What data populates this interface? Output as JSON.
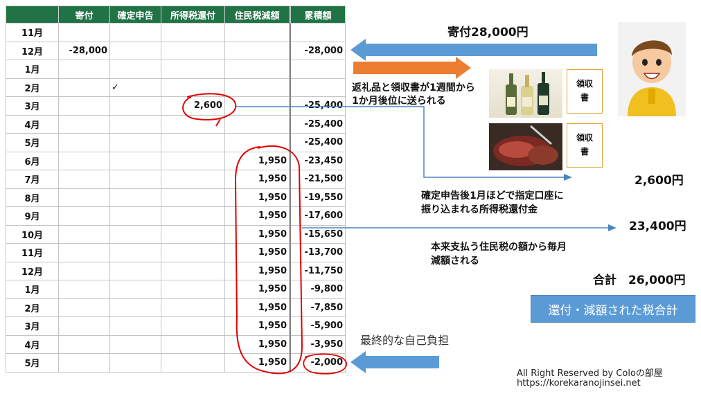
{
  "table": {
    "headers": [
      "",
      "寄付",
      "確定申告",
      "所得税還付",
      "住民税減額",
      "累積額"
    ],
    "rows": [
      [
        "11月",
        "",
        "",
        "",
        "",
        ""
      ],
      [
        "12月",
        "-28,000",
        "",
        "",
        "",
        "-28,000"
      ],
      [
        "1月",
        "",
        "",
        "",
        "",
        ""
      ],
      [
        "2月",
        "",
        "✓",
        "",
        "",
        ""
      ],
      [
        "3月",
        "",
        "",
        "2,600",
        "",
        "-25,400"
      ],
      [
        "4月",
        "",
        "",
        "",
        "",
        "-25,400"
      ],
      [
        "5月",
        "",
        "",
        "",
        "",
        "-25,400"
      ],
      [
        "6月",
        "",
        "",
        "",
        "1,950",
        "-23,450"
      ],
      [
        "7月",
        "",
        "",
        "",
        "1,950",
        "-21,500"
      ],
      [
        "8月",
        "",
        "",
        "",
        "1,950",
        "-19,550"
      ],
      [
        "9月",
        "",
        "",
        "",
        "1,950",
        "-17,600"
      ],
      [
        "10月",
        "",
        "",
        "",
        "1,950",
        "-15,650"
      ],
      [
        "11月",
        "",
        "",
        "",
        "1,950",
        "-13,700"
      ],
      [
        "12月",
        "",
        "",
        "",
        "1,950",
        "-11,750"
      ],
      [
        "1月",
        "",
        "",
        "",
        "1,950",
        "-9,800"
      ],
      [
        "2月",
        "",
        "",
        "",
        "1,950",
        "-7,850"
      ],
      [
        "3月",
        "",
        "",
        "",
        "1,950",
        "-5,900"
      ],
      [
        "4月",
        "",
        "",
        "",
        "1,950",
        "-3,950"
      ],
      [
        "5月",
        "",
        "",
        "",
        "1,950",
        "-2,000"
      ]
    ]
  },
  "annotations": {
    "donation": "寄付28,000円",
    "gift_line1": "返礼品と領収書が1週間から",
    "gift_line2": "1か月後位に送られる",
    "receipt": "領収書",
    "refund_amount": "2,600円",
    "refund_line1": "確定申告後1月ほどで指定口座に",
    "refund_line2": "振り込まれる所得税還付金",
    "resident_amount": "23,400円",
    "resident_line1": "本来支払う住民税の額から毎月",
    "resident_line2": "減額される",
    "total": "合計　26,000円",
    "total_button": "還付・減額された税合計",
    "final_burden": "最終的な自己負担"
  },
  "footer": {
    "copyright": "All Right Reserved by Coloの部屋",
    "url": "https://korekaranojinsei.net"
  },
  "colors": {
    "header_green": "#217346",
    "arrow_blue": "#5b9bd5",
    "arrow_orange": "#ed7d31",
    "circle_red": "#e00000",
    "receipt_border": "#e0a030"
  },
  "icons": [
    "wine-bottles-image",
    "steak-image",
    "boy-avatar"
  ]
}
